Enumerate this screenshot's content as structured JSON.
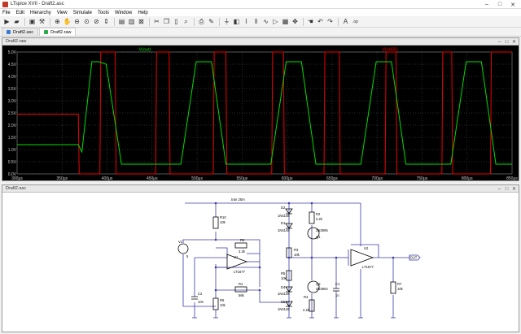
{
  "window": {
    "title": "LTspice XVII - Draft2.asc"
  },
  "menu": [
    "File",
    "Edit",
    "Hierarchy",
    "View",
    "Simulate",
    "Tools",
    "Window",
    "Help"
  ],
  "toolbar_icons": [
    "run-icon",
    "open-icon",
    "save-icon",
    "control-panel-icon",
    "zoom-in-icon",
    "pan-icon",
    "zoom-out-icon",
    "zoom-fit-icon",
    "cancel-zoom-icon",
    "autorange-icon",
    "tile-horizontal-icon",
    "tile-vertical-icon",
    "close-all-icon",
    "cut-icon",
    "copy-icon",
    "paste-icon",
    "find-icon",
    "print-icon",
    "wire-icon",
    "ground-icon",
    "label-icon",
    "resistor-icon",
    "capacitor-icon",
    "inductor-icon",
    "diode-icon",
    "component-icon",
    "move-icon",
    "drag-icon",
    "undo-icon",
    "redo-icon",
    "text-icon",
    "spice-directive-icon"
  ],
  "tabs": [
    {
      "label": "Draft2.asc"
    },
    {
      "label": "Draft2.raw"
    }
  ],
  "plot_window": {
    "title": "Draft2.raw"
  },
  "schematic_window": {
    "title": "Draft2.asc"
  },
  "chart_data": {
    "type": "line",
    "background": "#000000",
    "grid": true,
    "xlim": [
      300,
      850
    ],
    "ylim": [
      0.0,
      5.0
    ],
    "x_ticks": [
      "300µs",
      "350µs",
      "400µs",
      "450µs",
      "500µs",
      "550µs",
      "600µs",
      "650µs",
      "700µs",
      "750µs",
      "800µs",
      "850µs"
    ],
    "y_ticks": [
      "0.0V",
      "0.5V",
      "1.0V",
      "1.5V",
      "2.0V",
      "2.5V",
      "3.0V",
      "3.5V",
      "4.0V",
      "4.5V",
      "5.0V"
    ],
    "series": [
      {
        "name": "V(out)",
        "color": "#00dd00",
        "x": [
          300,
          368,
          372,
          383,
          391,
          399,
          416,
          432,
          482,
          499,
          516,
          532,
          582,
          599,
          616,
          632,
          682,
          699,
          716,
          732,
          782,
          799,
          816,
          832,
          850
        ],
        "y": [
          1.2,
          1.2,
          0.9,
          4.6,
          4.6,
          4.5,
          0.4,
          0.4,
          0.4,
          4.6,
          4.6,
          0.4,
          0.4,
          4.6,
          4.6,
          0.4,
          0.4,
          4.6,
          4.6,
          0.4,
          0.4,
          4.6,
          4.6,
          0.4,
          0.4
        ]
      },
      {
        "name": "V(n005)",
        "color": "#ee0000",
        "x": [
          300,
          368,
          369,
          392,
          393,
          409,
          410,
          454,
          455,
          469,
          470,
          518,
          519,
          532,
          533,
          583,
          584,
          596,
          597,
          641,
          642,
          658,
          659,
          709,
          710,
          721,
          722,
          772,
          773,
          783,
          784,
          826,
          827,
          850
        ],
        "y": [
          2.45,
          2.45,
          0.0,
          0.0,
          5.0,
          5.0,
          0.0,
          0.0,
          5.0,
          5.0,
          0.0,
          0.0,
          5.0,
          5.0,
          0.0,
          0.0,
          5.0,
          5.0,
          0.0,
          0.0,
          5.0,
          5.0,
          0.0,
          0.0,
          5.0,
          5.0,
          0.0,
          0.0,
          5.0,
          5.0,
          0.0,
          0.0,
          5.0,
          5.0
        ]
      }
    ]
  },
  "schematic": {
    "labels": {
      "tran": ".tran 25m",
      "v1": "V1",
      "v1_val": "5",
      "r10": "R10",
      "r10_val": "10k",
      "r9": "R9",
      "r9_val": "3.3k",
      "u1": "U1",
      "u1_part": "LT1677",
      "r1": "R1",
      "r1_val": "56k",
      "c2": "C2",
      "c2_val": "10n",
      "r6": "R6",
      "r6_val": "10k",
      "d2": "D2",
      "d2_part": "1N4148",
      "d1": "D1",
      "d1_part": "1N4148",
      "r2": "R2",
      "r2_val": "2.2k",
      "q1": "Q1",
      "q1_part": "2N3906",
      "r3": "R3",
      "r3_val": "10k",
      "r5": "R5",
      "r5_val": "10k",
      "q2": "Q2",
      "q2_part": "2N3904",
      "d4": "D4",
      "d4_part": "1N4148",
      "d5": "D5",
      "d5_part": "1N4148",
      "r4": "R4",
      "r4_val": "2.2k",
      "c1": "C1",
      "c1_val": "1n",
      "u2": "U2",
      "u2_part": "LT1677",
      "r7": "R7",
      "r7_val": "10k",
      "out": "OUT"
    }
  }
}
